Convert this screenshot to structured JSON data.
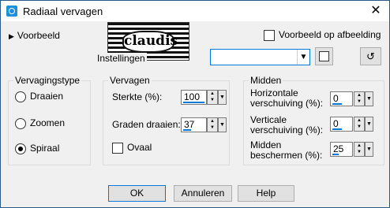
{
  "window": {
    "title": "Radiaal vervagen"
  },
  "preview": {
    "toggle_label": "Voorbeeld",
    "on_image_label": "Voorbeeld op afbeelding",
    "on_image_checked": false
  },
  "logo": {
    "text": "claudis"
  },
  "settings": {
    "label": "Instellingen",
    "preset_value": ""
  },
  "blur_type": {
    "title": "Vervagingstype",
    "options": [
      {
        "label": "Draaien",
        "selected": false
      },
      {
        "label": "Zoomen",
        "selected": false
      },
      {
        "label": "Spiraal",
        "selected": true
      }
    ]
  },
  "blur": {
    "title": "Vervagen",
    "strength_label": "Sterkte (%):",
    "strength_value": "100",
    "twist_label": "Graden draaien:",
    "twist_value": "37",
    "oval_label": "Ovaal",
    "oval_checked": false
  },
  "center": {
    "title": "Midden",
    "h_offset_label_1": "Horizontale",
    "h_offset_label_2": "verschuiving (%):",
    "h_offset_value": "0",
    "v_offset_label_1": "Verticale",
    "v_offset_label_2": "verschuiving (%):",
    "v_offset_value": "0",
    "protect_label_1": "Midden",
    "protect_label_2": "beschermen (%):",
    "protect_value": "25"
  },
  "buttons": {
    "ok": "OK",
    "cancel": "Annuleren",
    "help": "Help"
  }
}
